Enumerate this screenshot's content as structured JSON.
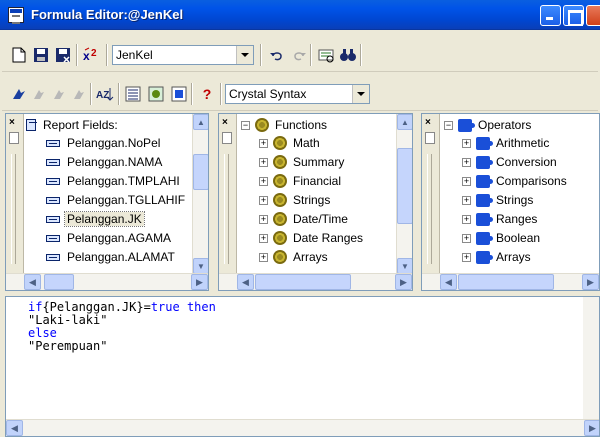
{
  "window": {
    "title": "Formula Editor:@JenKel"
  },
  "toolbar1": {
    "formula_name": "JenKel",
    "icons": [
      "new-icon",
      "save-icon",
      "save-close-icon",
      "check-icon",
      "undo-icon",
      "redo-icon",
      "browse-icon",
      "find-icon"
    ]
  },
  "toolbar2": {
    "syntax": "Crystal Syntax",
    "icons": [
      "bookmark-icon",
      "next-bookmark-icon",
      "prev-bookmark-icon",
      "clear-bookmarks-icon",
      "sort-icon",
      "toggle-fields-icon",
      "toggle-functions-icon",
      "toggle-operators-icon",
      "help-icon"
    ]
  },
  "fields_panel": {
    "root": "Report Fields:",
    "items": [
      "Pelanggan.NoPel",
      "Pelanggan.NAMA",
      "Pelanggan.TMPLAHI",
      "Pelanggan.TGLLAHIF",
      "Pelanggan.JK",
      "Pelanggan.AGAMA",
      "Pelanggan.ALAMAT"
    ],
    "selected": "Pelanggan.JK"
  },
  "functions_panel": {
    "root": "Functions",
    "items": [
      "Math",
      "Summary",
      "Financial",
      "Strings",
      "Date/Time",
      "Date Ranges",
      "Arrays"
    ]
  },
  "operators_panel": {
    "root": "Operators",
    "items": [
      "Arithmetic",
      "Conversion",
      "Comparisons",
      "Strings",
      "Ranges",
      "Boolean",
      "Arrays"
    ]
  },
  "editor": {
    "lines": [
      {
        "kw1": "if",
        "text": "{Pelanggan.JK}=",
        "kw2": "true then"
      },
      {
        "text": "\"Laki-laki\""
      },
      {
        "kw1": "else"
      },
      {
        "text": "\"Perempuan\""
      }
    ]
  }
}
